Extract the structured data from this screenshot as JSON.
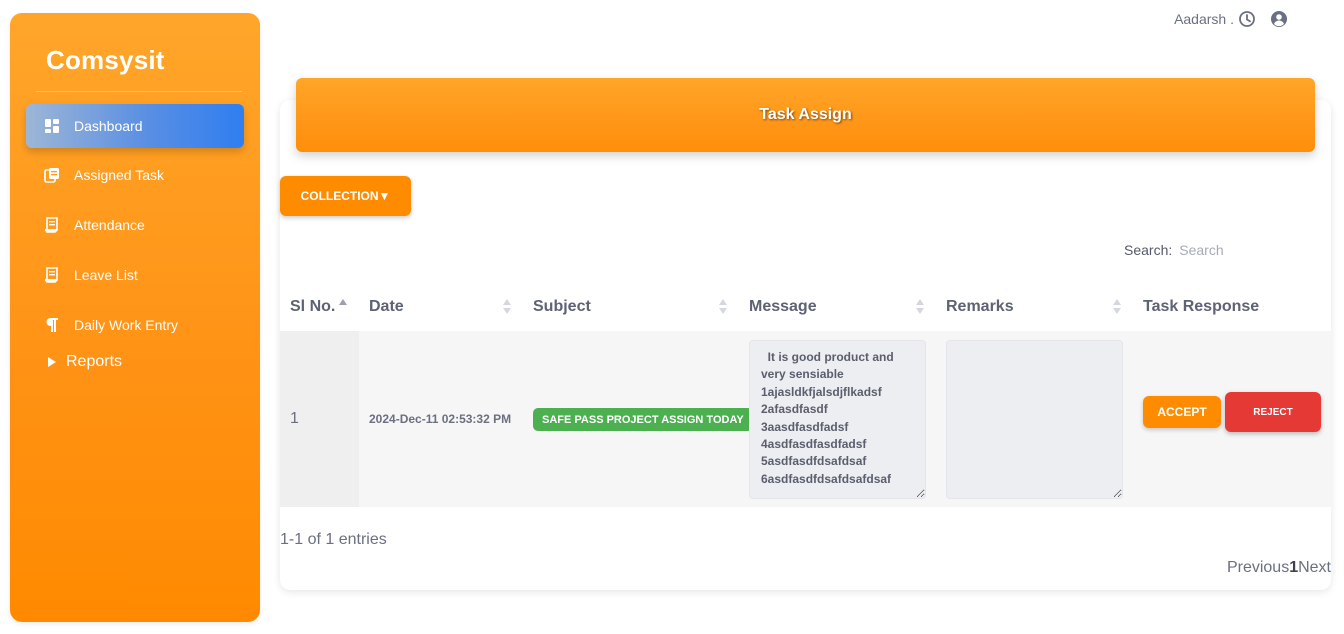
{
  "sidebar": {
    "brand": "Comsysit",
    "items": [
      {
        "label": "Dashboard",
        "icon": "dashboard-icon",
        "active": true
      },
      {
        "label": "Assigned Task",
        "icon": "copy-icon",
        "active": false
      },
      {
        "label": "Attendance",
        "icon": "receipt-icon",
        "active": false
      },
      {
        "label": "Leave List",
        "icon": "receipt-icon",
        "active": false
      },
      {
        "label": "Daily Work Entry",
        "icon": "paragraph-icon",
        "active": false
      }
    ],
    "reports_label": "Reports"
  },
  "topbar": {
    "username": "Aadarsh ."
  },
  "page": {
    "banner_title": "Task Assign",
    "collection_button": "COLLECTION▼",
    "search_label": "Search:",
    "search_placeholder": "Search"
  },
  "table": {
    "columns": [
      "Sl No.",
      "Date",
      "Subject",
      "Message",
      "Remarks",
      "Task Response"
    ],
    "rows": [
      {
        "sl": "1",
        "date": "2024-Dec-11 02:53:32 PM",
        "subject": "SAFE PASS PROJECT ASSIGN TODAY",
        "message": "  It is good product and very sensiable\n1ajasldkfjalsdjflkadsf\n2afasdfasdf\n3aasdfasdfadsf\n4asdfasdfasdfadsf\n5asdfasdfdsafdsaf\n6asdfasdfdsafdsafdsaf",
        "remarks": "",
        "accept_label": "ACCEPT",
        "reject_label": "REJECT"
      }
    ],
    "entries_info": "1-1 of 1 entries",
    "pager": {
      "prev": "Previous",
      "current": "1",
      "next": "Next"
    }
  },
  "colors": {
    "accent_orange": "#ff8c00",
    "active_blue": "#2f7ef0",
    "badge_green": "#4caf50",
    "reject_red": "#e53935"
  }
}
